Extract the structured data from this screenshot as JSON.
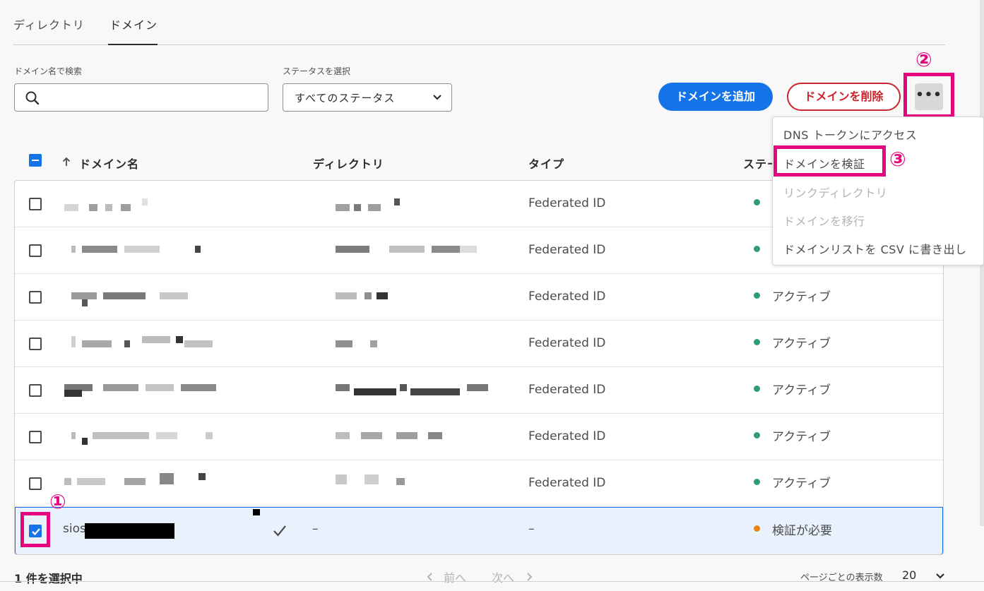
{
  "tabs": [
    {
      "label": "ディレクトリ"
    },
    {
      "label": "ドメイン"
    }
  ],
  "filters": {
    "search_label": "ドメイン名で検索",
    "search_value": "",
    "status_label": "ステータスを選択",
    "status_value": "すべてのステータス"
  },
  "buttons": {
    "add": "ドメインを追加",
    "delete": "ドメインを削除",
    "more": "•••"
  },
  "steps": {
    "one": "①",
    "two": "②",
    "three": "③"
  },
  "menu": {
    "items": [
      {
        "label": "DNS トークンにアクセス"
      },
      {
        "label": "ドメインを検証"
      },
      {
        "label": "リンクディレクトリ"
      },
      {
        "label": "ドメインを移行"
      },
      {
        "label": "ドメインリストを CSV に書き出し"
      }
    ]
  },
  "table": {
    "columns": [
      "ドメイン名",
      "ディレクトリ",
      "タイプ",
      "ステータス"
    ],
    "status_header_visible": "ステー",
    "sort_icon": "arrow-up-icon",
    "rows": [
      {
        "domain": "",
        "directory": "",
        "type": "Federated ID",
        "status": "",
        "checked": false
      },
      {
        "domain": "",
        "directory": "",
        "type": "Federated ID",
        "status": "",
        "checked": false
      },
      {
        "domain": "",
        "directory": "",
        "type": "Federated ID",
        "status": "アクティブ",
        "checked": false
      },
      {
        "domain": "",
        "directory": "",
        "type": "Federated ID",
        "status": "アクティブ",
        "checked": false
      },
      {
        "domain": "",
        "directory": "",
        "type": "Federated ID",
        "status": "アクティブ",
        "checked": false
      },
      {
        "domain": "",
        "directory": "",
        "type": "Federated ID",
        "status": "アクティブ",
        "checked": false
      },
      {
        "domain": "",
        "directory": "",
        "type": "Federated ID",
        "status": "アクティブ",
        "checked": false
      },
      {
        "domain": "sios",
        "directory": "–",
        "type": "–",
        "status": "検証が必要",
        "checked": true
      }
    ]
  },
  "colors": {
    "accent": "#1473e6",
    "danger": "#c9252d",
    "active": "#2d9d78",
    "warning": "#e68619",
    "highlight": "#e5067f"
  },
  "footer": {
    "selection": "1 件を選択中",
    "prev": "前へ",
    "next": "次へ",
    "per_page_label": "ページごとの表示数",
    "per_page_value": "20"
  }
}
